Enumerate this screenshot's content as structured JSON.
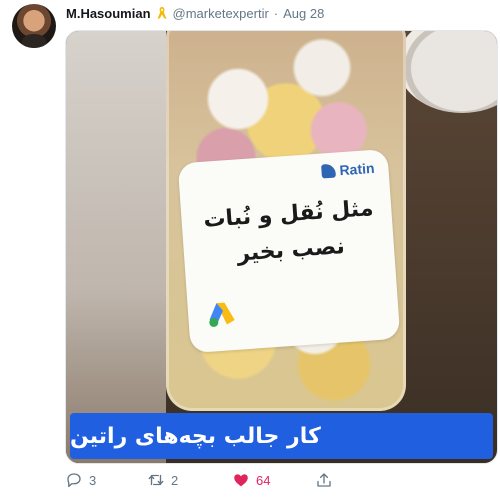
{
  "author": {
    "name": "M.Hasoumian",
    "handle": "@marketexpertir",
    "separator": "·",
    "date": "Aug 28"
  },
  "media": {
    "label_brand": "Ratin",
    "label_line1": "مثل نُقل و نُبات",
    "label_line2": "نصب بخیر",
    "caption": "کار جالب بچه‌های راتین"
  },
  "actions": {
    "reply_count": "3",
    "retweet_count": "2",
    "like_count": "64"
  },
  "colors": {
    "caption_bg": "#1f5fe0",
    "like": "#e0245e",
    "muted_text": "#657786",
    "ribbon": "#f5b800"
  },
  "icons": [
    "ribbon-icon",
    "reply-icon",
    "retweet-icon",
    "heart-icon",
    "share-icon",
    "google-ads-icon",
    "ratin-logo-icon"
  ]
}
